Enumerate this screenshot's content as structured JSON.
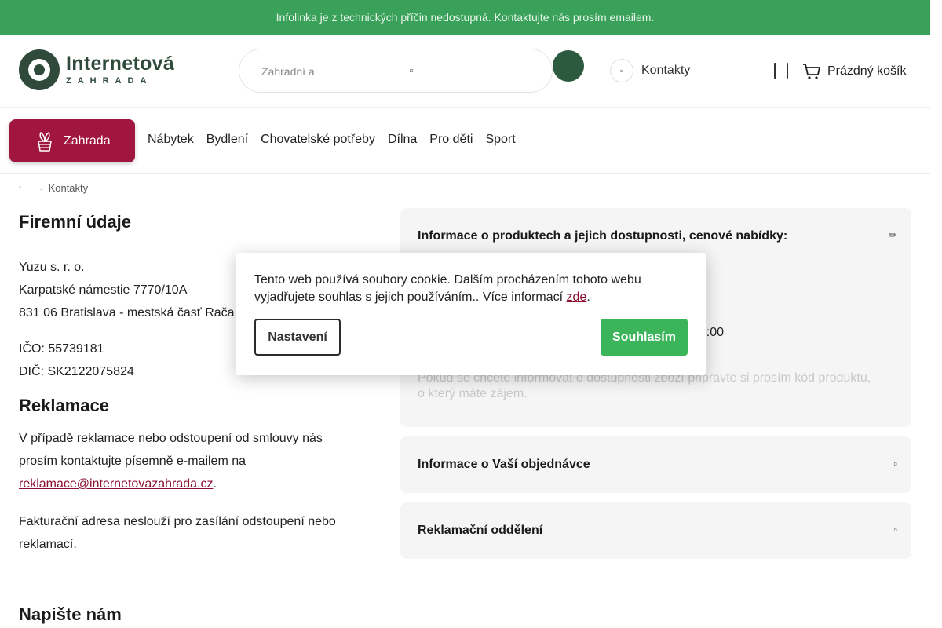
{
  "topbar": {
    "notice": "Infolinka je z technických příčin nedostupná. Kontaktujte nás prosím emailem."
  },
  "header": {
    "logo_name": "Internetová",
    "logo_sub": "ZAHRADA",
    "search_placeholder": "Zahradní a",
    "contacts_label": "Kontakty",
    "cart_label": "Prázdný košík"
  },
  "nav": {
    "primary_label": "Zahrada",
    "items": [
      "Nábytek",
      "Bydlení",
      "Chovatelské potřeby",
      "Dílna",
      "Pro děti",
      "Sport"
    ]
  },
  "breadcrumb": {
    "current": "Kontakty"
  },
  "company": {
    "title": "Firemní údaje",
    "lines": [
      "Yuzu s. r. o.",
      "Karpatské námestie 7770/10A",
      "831 06 Bratislava - mestská časť Rača"
    ],
    "ico": "IČO: 55739181",
    "dic": "DIČ: SK2122075824"
  },
  "reklamace": {
    "title": "Reklamace",
    "text_before": "V případě reklamace nebo odstoupení od smlouvy nás prosím kontaktujte písemně e-mailem na ",
    "email": "reklamace@internetovazahrada.cz",
    "text_after": ".",
    "note": "Fakturační adresa neslouží pro zasílání odstoupení nebo reklamací."
  },
  "napiste": {
    "title": "Napište nám"
  },
  "accordion": {
    "item1_title": "Informace o produktech a jejich dostupnosti, cenové nabídky:",
    "item1_hours_fragment": ":00",
    "item1_note": "Pokud se chcete informovat o dostupnosti zboží připravte si prosím kód produktu, o který máte zájem.",
    "item2_title": "Informace o Vaší objednávce",
    "item3_title": "Reklamační oddělení"
  },
  "cookie": {
    "text": "Tento web používá soubory cookie. Dalším procházením tohoto webu vyjadřujete souhlas s jejich používáním.. Více informací ",
    "link": "zde",
    "text_end": ".",
    "settings_label": "Nastavení",
    "agree_label": "Souhlasím"
  },
  "colors": {
    "topbar_green": "#3aa15a",
    "brand_dark_green": "#2f4a3b",
    "primary_burgundy": "#a0163e",
    "agree_green": "#3bb45a"
  },
  "icons": [
    "search-icon",
    "info-icon",
    "user-icon",
    "cart-icon",
    "plant-icon",
    "home-icon",
    "pencil-icon",
    "chevron-icon"
  ]
}
